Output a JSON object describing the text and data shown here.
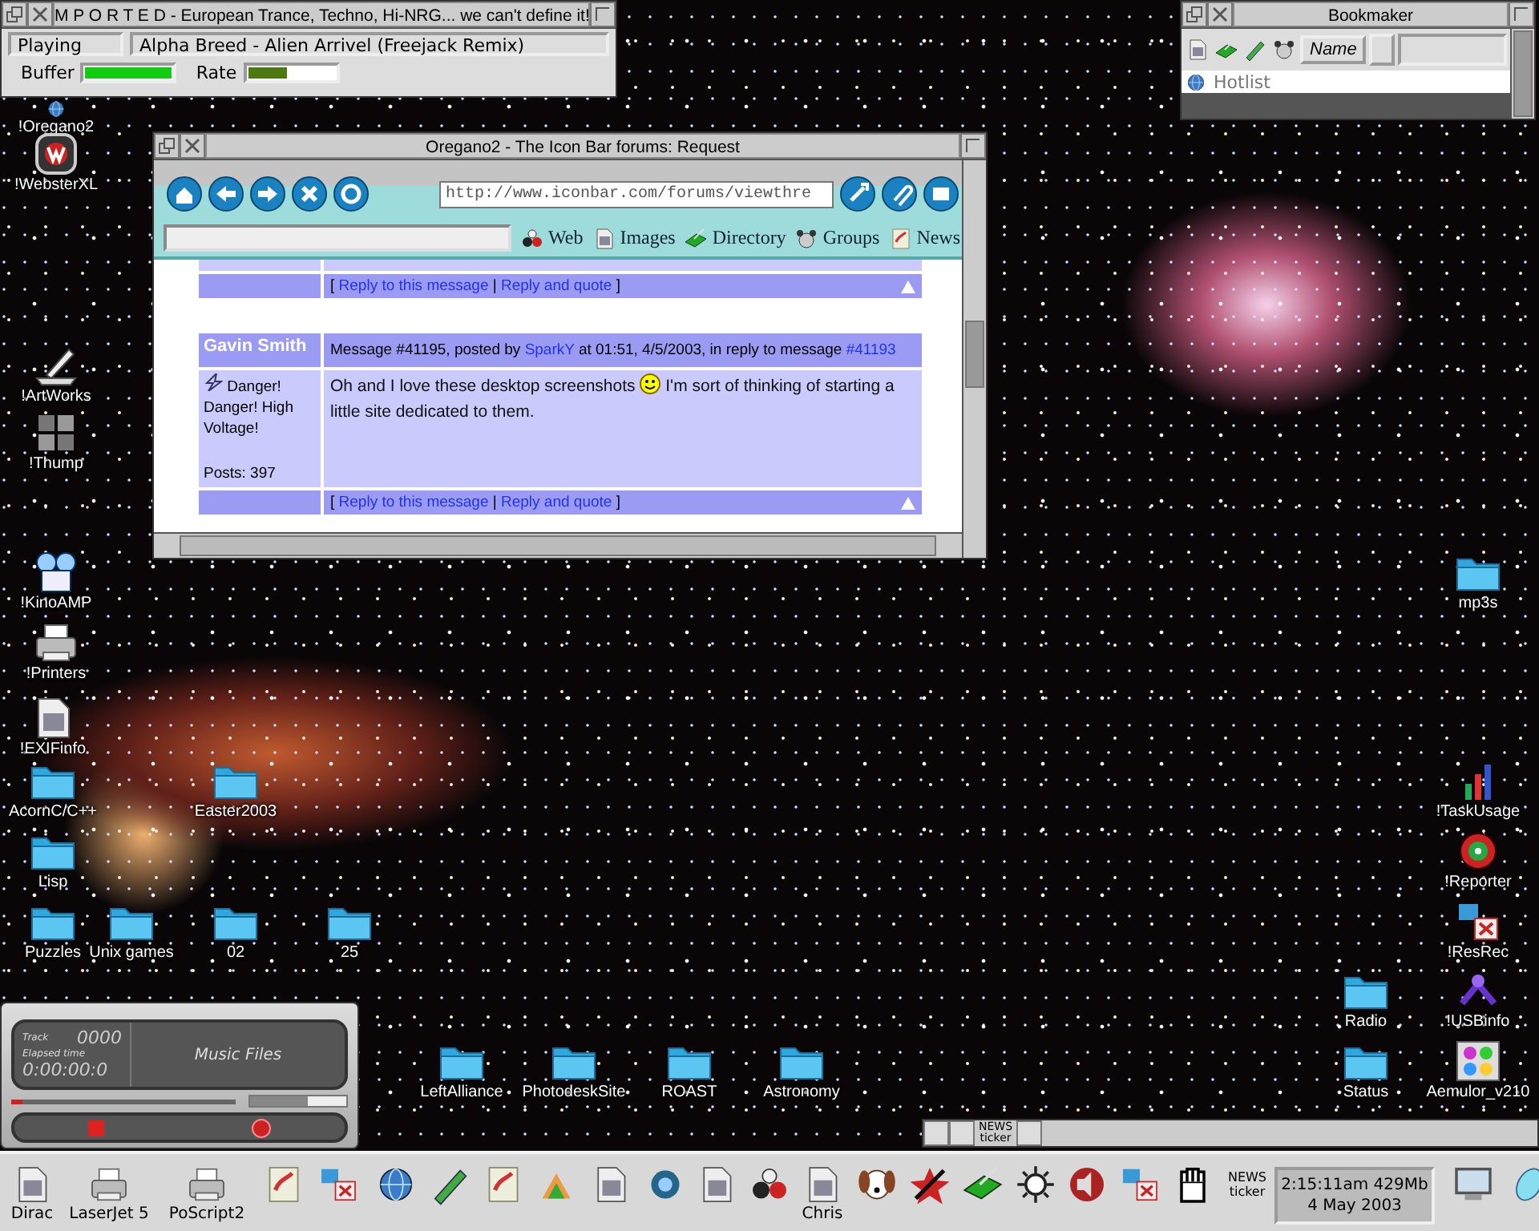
{
  "player": {
    "title": "M P O R T E D - European Trance, Techno, Hi-NRG... we can't define it!",
    "status": "Playing",
    "track": "Alpha Breed - Alien Arrivel (Freejack Remix)",
    "meters": [
      {
        "label": "Buffer",
        "level": 1.0
      },
      {
        "label": "Rate",
        "level": 0.45
      }
    ]
  },
  "bookmaker": {
    "title": "Bookmaker",
    "sort_button": "Name",
    "items": [
      "Hotlist"
    ]
  },
  "browser": {
    "title": "Oregano2 - The Icon Bar forums: Request",
    "url": "http://www.iconbar.com/forums/viewthre",
    "search_links": [
      "Web",
      "Images",
      "Directory",
      "Groups",
      "News"
    ],
    "previous_reply_bar": [
      {
        "kind": "text",
        "text": "["
      },
      {
        "kind": "link",
        "text": "Reply to this message"
      },
      {
        "kind": "text",
        "text": "|"
      },
      {
        "kind": "link",
        "text": "Reply and quote"
      },
      {
        "kind": "text",
        "text": "]"
      }
    ],
    "post": {
      "author": "Gavin Smith",
      "header": [
        {
          "kind": "text",
          "text": "Message #41195, posted by"
        },
        {
          "kind": "link",
          "text": "SparkY"
        },
        {
          "kind": "text",
          "text": "at 01:51, 4/5/2003, in reply to message"
        },
        {
          "kind": "link",
          "text": "#41193"
        }
      ],
      "user_title": "Danger! Danger! High Voltage!",
      "post_count": "Posts: 397",
      "body": [
        {
          "kind": "text",
          "text": "Oh and I love these desktop screenshots"
        },
        {
          "kind": "smiley"
        },
        {
          "kind": "text",
          "text": "I'm sort of thinking of starting a little site dedicated to them."
        }
      ],
      "reply_bar": [
        {
          "kind": "text",
          "text": "["
        },
        {
          "kind": "link",
          "text": "Reply to this message"
        },
        {
          "kind": "text",
          "text": "|"
        },
        {
          "kind": "link",
          "text": "Reply and quote"
        },
        {
          "kind": "text",
          "text": "]"
        }
      ]
    }
  },
  "desktop_icons": [
    {
      "label": "!Oregano2",
      "kind": "app"
    },
    {
      "label": "!WebsterXL",
      "kind": "app"
    },
    {
      "label": "!ArtWorks",
      "kind": "app"
    },
    {
      "label": "!Thump",
      "kind": "app"
    },
    {
      "label": "!KinoAMP",
      "kind": "app"
    },
    {
      "label": "!Printers",
      "kind": "app"
    },
    {
      "label": "!EXIFinfo",
      "kind": "app"
    },
    {
      "label": "AcornC/C++",
      "kind": "folder"
    },
    {
      "label": "Easter2003",
      "kind": "folder"
    },
    {
      "label": "Lisp",
      "kind": "folder"
    },
    {
      "label": "Puzzles",
      "kind": "folder"
    },
    {
      "label": "Unix games",
      "kind": "folder"
    },
    {
      "label": "02",
      "kind": "folder"
    },
    {
      "label": "25",
      "kind": "folder"
    },
    {
      "label": "LeftAlliance",
      "kind": "folder"
    },
    {
      "label": "PhotodeskSite",
      "kind": "folder"
    },
    {
      "label": "ROAST",
      "kind": "folder"
    },
    {
      "label": "Astronomy",
      "kind": "folder"
    },
    {
      "label": "mp3s",
      "kind": "folder"
    },
    {
      "label": "!TaskUsage",
      "kind": "app"
    },
    {
      "label": "!Reporter",
      "kind": "app"
    },
    {
      "label": "!ResRec",
      "kind": "app"
    },
    {
      "label": "Radio",
      "kind": "folder"
    },
    {
      "label": "!USBinfo",
      "kind": "app"
    },
    {
      "label": "Status",
      "kind": "folder"
    },
    {
      "label": "Aemulor_v210",
      "kind": "app"
    }
  ],
  "cd_player": {
    "track_label": "Track",
    "track": "0000",
    "elapsed_label": "Elapsed time",
    "elapsed": "0:00:00:0",
    "display": "Music Files",
    "seek": {
      "level": 0.05
    },
    "volume": {
      "level": 0.6
    }
  },
  "ticker_window": {
    "label": "NEWS ticker"
  },
  "iconbar": {
    "items": [
      {
        "label": "Dirac"
      },
      {
        "label": "LaserJet 5"
      },
      {
        "label": "PoScript2"
      },
      {
        "label": "Chris"
      },
      {
        "label": "NEWS ticker"
      }
    ],
    "clock": {
      "time": "2:15:11am 429Mb",
      "date": "4 May 2003"
    }
  }
}
